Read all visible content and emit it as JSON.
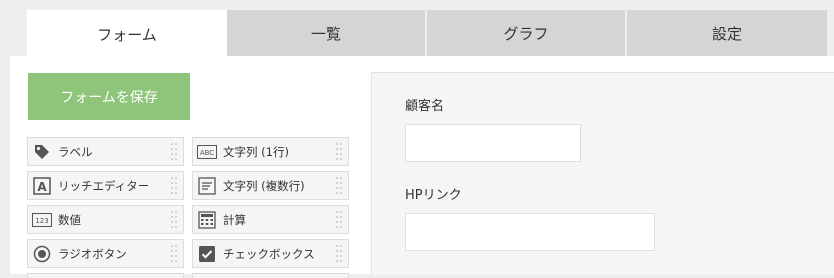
{
  "tabs": [
    {
      "label": "フォーム",
      "active": true
    },
    {
      "label": "一覧",
      "active": false
    },
    {
      "label": "グラフ",
      "active": false
    },
    {
      "label": "設定",
      "active": false
    }
  ],
  "toolbar": {
    "save_label": "フォームを保存",
    "save_color": "#8fc57a"
  },
  "palette": {
    "items": [
      {
        "label": "ラベル",
        "icon": "tag-icon"
      },
      {
        "label": "文字列 (1行)",
        "icon": "abc-text-icon"
      },
      {
        "label": "リッチエディター",
        "icon": "rich-editor-icon"
      },
      {
        "label": "文字列 (複数行)",
        "icon": "multiline-text-icon"
      },
      {
        "label": "数値",
        "icon": "number-icon"
      },
      {
        "label": "計算",
        "icon": "calculator-icon"
      },
      {
        "label": "ラジオボタン",
        "icon": "radio-icon"
      },
      {
        "label": "チェックボックス",
        "icon": "checkbox-icon"
      }
    ]
  },
  "form": {
    "fields": [
      {
        "label": "顧客名",
        "value": ""
      },
      {
        "label": "HPリンク",
        "value": ""
      }
    ]
  }
}
